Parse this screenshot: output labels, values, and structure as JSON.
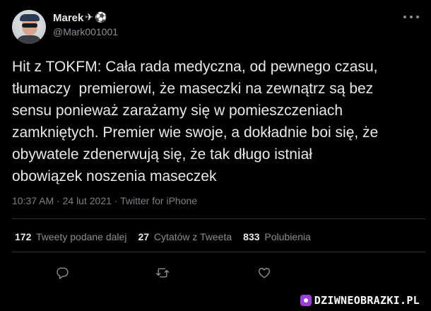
{
  "author": {
    "name": "Marek",
    "badges": [
      "✈",
      "⚽"
    ],
    "handle": "@Mark001001"
  },
  "tweet": {
    "text": "Hit z TOKFM: Cała rada medyczna, od pewnego czasu,\ntłumaczy  premierowi, że maseczki na zewnątrz są bez\nsensu ponieważ zarażamy się w pomieszczeniach\nzamkniętych. Premier wie swoje, a dokładnie boi się, że\nobywatele zdenerwują się, że tak długo istniał\nobowiązek noszenia maseczek",
    "time": "10:37 AM",
    "date": "24 lut 2021",
    "separator": "·",
    "source": "Twitter for iPhone"
  },
  "stats": {
    "retweets": {
      "count": "172",
      "label": "Tweety podane dalej"
    },
    "quotes": {
      "count": "27",
      "label": "Cytatów z Tweeta"
    },
    "likes": {
      "count": "833",
      "label": "Polubienia"
    }
  },
  "icons": {
    "more": "more-dots-icon",
    "reply": "reply-icon",
    "retweet": "retweet-icon",
    "like": "heart-icon"
  },
  "watermark": {
    "text": "DZIWNEOBRAZKI.PL"
  },
  "colors": {
    "background": "#000000",
    "text": "#e7e9ea",
    "secondary": "#8a8f94",
    "divider": "#2f3336",
    "watermark_logo": "#9b3fd6"
  }
}
